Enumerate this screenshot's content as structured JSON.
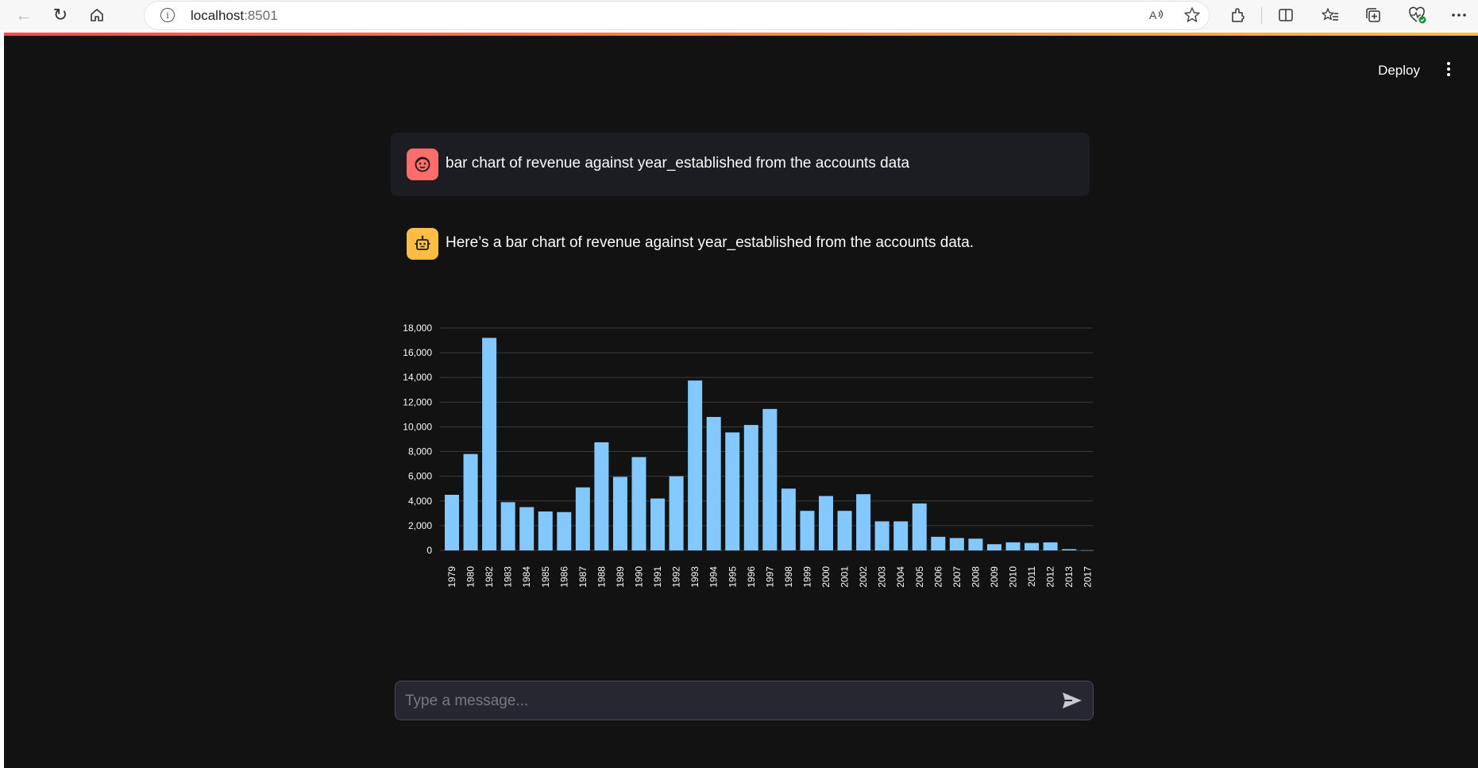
{
  "browser": {
    "back_glyph": "←",
    "reload_glyph": "↻",
    "home_glyph": "⌂",
    "url_host": "localhost",
    "url_port": ":8501",
    "info_glyph": "i"
  },
  "app": {
    "deploy_label": "Deploy"
  },
  "chat": {
    "user_message": "bar chart of revenue against year_established from the accounts data",
    "assistant_message": "Here’s a bar chart of revenue against year_established from the accounts data.",
    "input_placeholder": "Type a message...",
    "user_avatar_color": "#ff6c6c",
    "assistant_avatar_color": "#ffbd45"
  },
  "chart_data": {
    "type": "bar",
    "xlabel": "",
    "ylabel": "",
    "ylim": [
      0,
      18000
    ],
    "yticks": [
      0,
      2000,
      4000,
      6000,
      8000,
      10000,
      12000,
      14000,
      16000,
      18000
    ],
    "ytick_labels": [
      "0",
      "2,000",
      "4,000",
      "6,000",
      "8,000",
      "10,000",
      "12,000",
      "14,000",
      "16,000",
      "18,000"
    ],
    "bar_color": "#83c9ff",
    "grid": true,
    "categories": [
      "1979",
      "1980",
      "1982",
      "1983",
      "1984",
      "1985",
      "1986",
      "1987",
      "1988",
      "1989",
      "1990",
      "1991",
      "1992",
      "1993",
      "1994",
      "1995",
      "1996",
      "1997",
      "1998",
      "1999",
      "2000",
      "2001",
      "2002",
      "2003",
      "2004",
      "2005",
      "2006",
      "2007",
      "2008",
      "2009",
      "2010",
      "2011",
      "2012",
      "2013",
      "2017"
    ],
    "values": [
      4500,
      7800,
      17200,
      3900,
      3500,
      3150,
      3100,
      5100,
      8750,
      5950,
      7550,
      4200,
      6000,
      13750,
      10800,
      9550,
      10150,
      11450,
      5000,
      3200,
      4400,
      3200,
      4550,
      2350,
      2350,
      3800,
      1100,
      1000,
      950,
      500,
      650,
      600,
      650,
      100,
      10
    ]
  }
}
